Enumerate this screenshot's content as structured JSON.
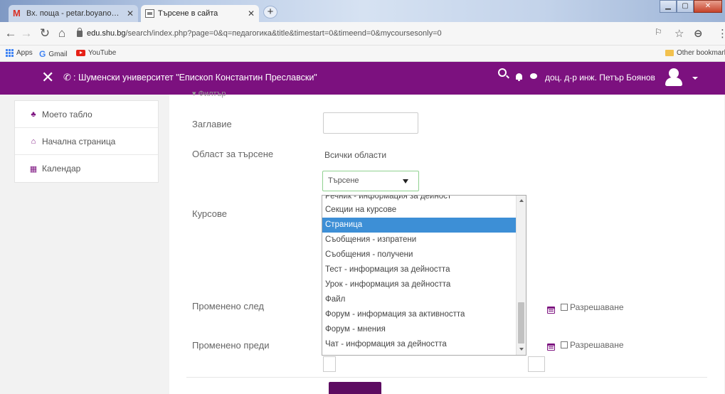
{
  "browser": {
    "tabs": [
      {
        "label": "Вх. поща - petar.boyanov@shu.b",
        "icon": "gmail-icon",
        "active": false
      },
      {
        "label": "Търсене в сайта",
        "icon": "site-icon",
        "active": true
      }
    ],
    "url_prefix": "edu.shu.bg",
    "url_rest": "/search/index.php?page=0&q=педагогика&title&timestart=0&timeend=0&mycoursesonly=0",
    "bookmarks": {
      "apps": "Apps",
      "gmail": "Gmail",
      "youtube": "YouTube",
      "other": "Other bookmarks"
    }
  },
  "navbar": {
    "title": ": Шуменски университет \"Епископ Константин Преславски\"",
    "user": "доц. д-р инж. Петър Боянов",
    "color": "#7c117f"
  },
  "sidebar": {
    "items": [
      {
        "label": "Моето табло",
        "icon": "dashboard-icon"
      },
      {
        "label": "Начална страница",
        "icon": "home-icon"
      },
      {
        "label": "Календар",
        "icon": "calendar-icon"
      }
    ]
  },
  "form": {
    "filter_header": "▾ Филтър",
    "title_label": "Заглавие",
    "area_label": "Област за търсене",
    "area_value": "Всички области",
    "courses_label": "Курсове",
    "select_value": "Търсене",
    "options": [
      "Речник - информация за дейност",
      "Секции на курсове",
      "Страница",
      "Съобщения - изпратени",
      "Съобщения - получени",
      "Тест - информация за дейността",
      "Урок - информация за дейността",
      "Файл",
      "Форум - информация за активността",
      "Форум - мнения",
      "Чат - информация за дейността"
    ],
    "selected_option": "Страница",
    "modified_after_label": "Променено след",
    "modified_before_label": "Променено преди",
    "enable_label": "Разрешаване",
    "search_button": ""
  },
  "colors": {
    "accent": "#7c117f",
    "selection": "#3d8fd6",
    "button": "#5d0c61"
  }
}
